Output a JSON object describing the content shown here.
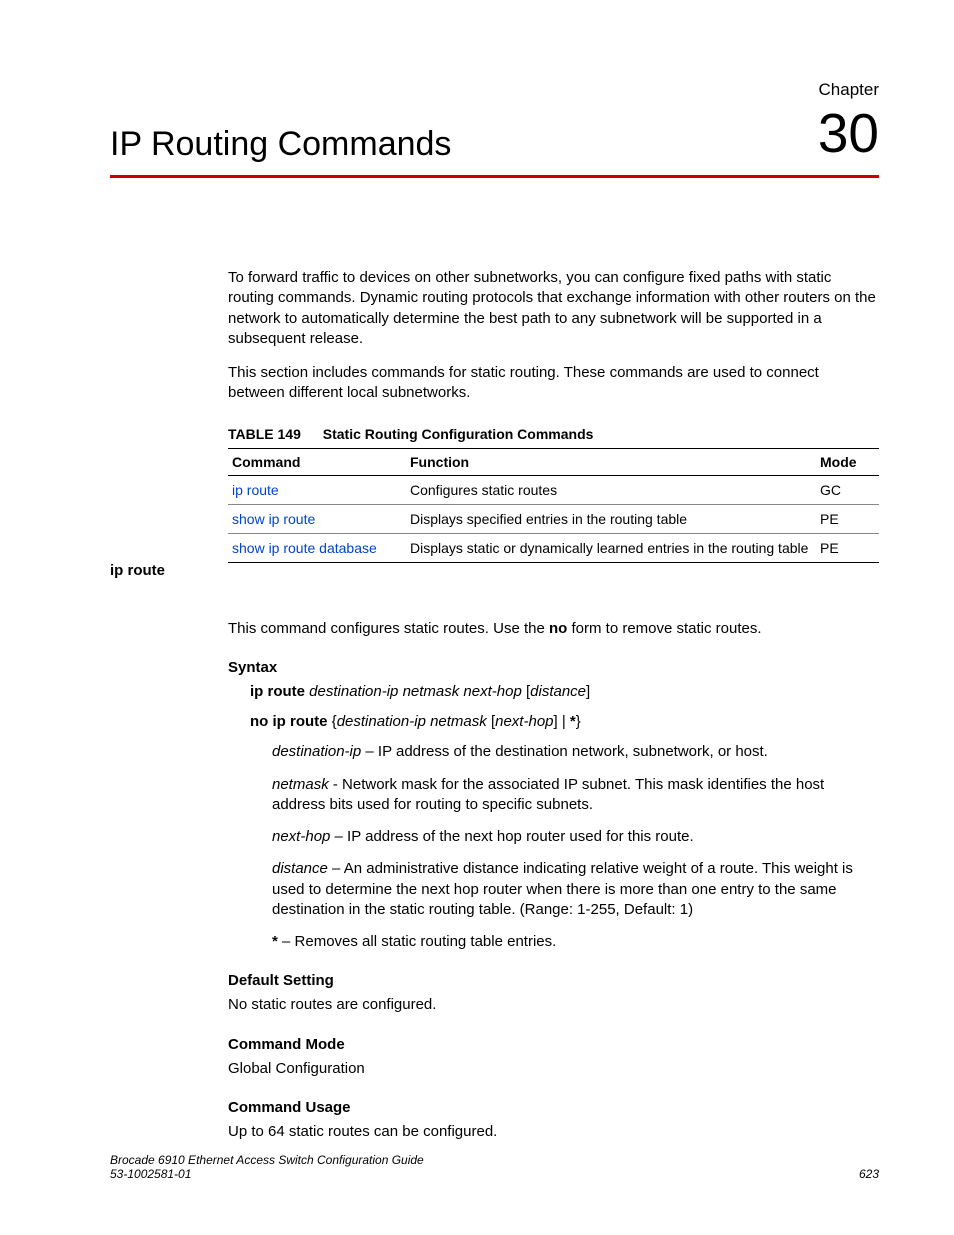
{
  "header": {
    "chapter_label": "Chapter",
    "chapter_num": "30",
    "title": "IP Routing Commands"
  },
  "intro": {
    "p1": "To forward traffic to devices on other subnetworks, you can configure fixed paths with static routing commands. Dynamic routing protocols that exchange information with other routers on the network to automatically determine the best path to any subnetwork will be supported in a subsequent release.",
    "p2": "This section includes commands for static routing. These commands are used to connect between different local subnetworks."
  },
  "table": {
    "label": "TABLE 149",
    "caption": "Static Routing Configuration Commands",
    "head": {
      "c1": "Command",
      "c2": "Function",
      "c3": "Mode"
    },
    "rows": [
      {
        "cmd": "ip route",
        "func": "Configures static routes",
        "mode": "GC"
      },
      {
        "cmd": "show ip route",
        "func": "Displays specified entries in the routing table",
        "mode": "PE"
      },
      {
        "cmd": "show ip route database",
        "func": "Displays static or dynamically learned entries in the routing table",
        "mode": "PE"
      }
    ]
  },
  "iproute": {
    "heading": "ip route",
    "desc_pre": "This command configures static routes. Use the ",
    "desc_bold": "no",
    "desc_post": " form to remove static routes.",
    "syntax_head": "Syntax",
    "s1": {
      "b": "ip route ",
      "i": "destination-ip netmask next-hop",
      "post1": " [",
      "i2": "distance",
      "post2": "]"
    },
    "s2": {
      "b": "no ip route ",
      "post1": "{",
      "i1": "destination-ip netmask",
      "post2": " [",
      "i2": "next-hop",
      "post3": "] | ",
      "b2": "*",
      "post4": "}"
    },
    "defs": {
      "d1_i": "destination-ip",
      "d1_t": " – IP address of the destination network, subnetwork, or host.",
      "d2_i": "netmask",
      "d2_t": " - Network mask for the associated IP subnet. This mask identifies the host address bits used for routing to specific subnets.",
      "d3_i": "next-hop",
      "d3_t": " – IP address of the next hop router used for this route.",
      "d4_i": "distance",
      "d4_t": " – An administrative distance indicating relative weight of a route. This weight is used to determine the next hop router when there is more than one entry to the same destination in the static routing table. (Range: 1-255, Default: 1)",
      "d5_b": "*",
      "d5_t": " – Removes all static routing table entries."
    },
    "default_head": "Default Setting",
    "default_text": "No static routes are configured.",
    "mode_head": "Command Mode",
    "mode_text": "Global Configuration",
    "usage_head": "Command Usage",
    "usage_text": "Up to 64 static routes can be configured."
  },
  "footer": {
    "left1": "Brocade 6910 Ethernet Access Switch Configuration Guide",
    "left2": "53-1002581-01",
    "right": "623"
  }
}
